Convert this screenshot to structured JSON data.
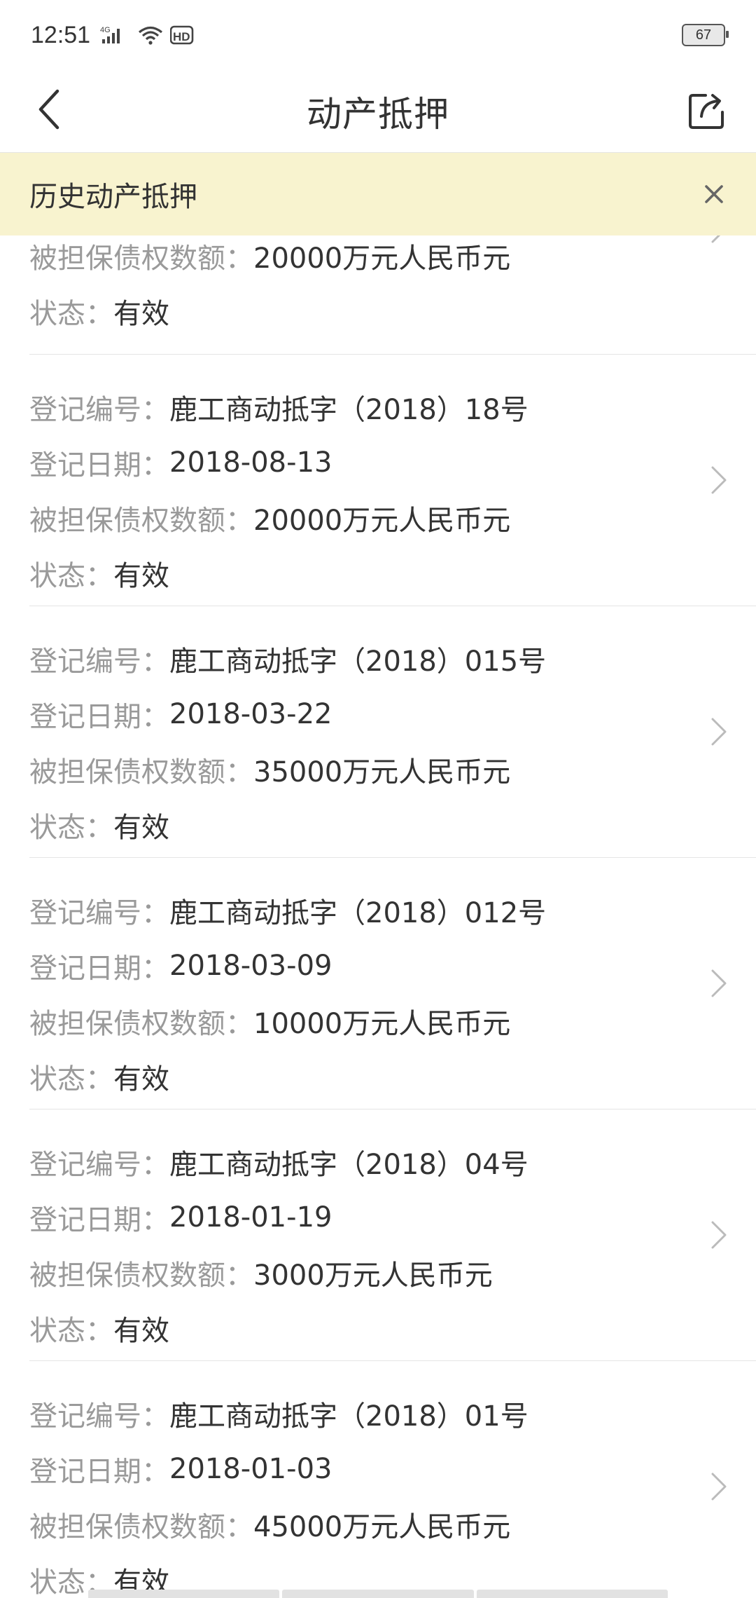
{
  "status_bar": {
    "time": "12:51",
    "network": "4G",
    "hd": "HD",
    "battery": "67"
  },
  "nav": {
    "title": "动产抵押"
  },
  "banner": {
    "text": "历史动产抵押"
  },
  "labels": {
    "reg_no": "登记编号：",
    "reg_date": "登记日期：",
    "amount": "被担保债权数额：",
    "status": "状态："
  },
  "partial_item": {
    "amount": "20000万元人民币元",
    "status": "有效"
  },
  "items": [
    {
      "reg_no": "鹿工商动抵字（2018）18号",
      "reg_date": "2018-08-13",
      "amount": "20000万元人民币元",
      "status": "有效"
    },
    {
      "reg_no": "鹿工商动抵字（2018）015号",
      "reg_date": "2018-03-22",
      "amount": "35000万元人民币元",
      "status": "有效"
    },
    {
      "reg_no": "鹿工商动抵字（2018）012号",
      "reg_date": "2018-03-09",
      "amount": "10000万元人民币元",
      "status": "有效"
    },
    {
      "reg_no": "鹿工商动抵字（2018）04号",
      "reg_date": "2018-01-19",
      "amount": "3000万元人民币元",
      "status": "有效"
    },
    {
      "reg_no": "鹿工商动抵字（2018）01号",
      "reg_date": "2018-01-03",
      "amount": "45000万元人民币元",
      "status": "有效"
    }
  ],
  "colors": {
    "banner_bg": "#f8f3cf",
    "label": "#9a9a9a",
    "value": "#333333",
    "divider": "#e5e5e5"
  }
}
